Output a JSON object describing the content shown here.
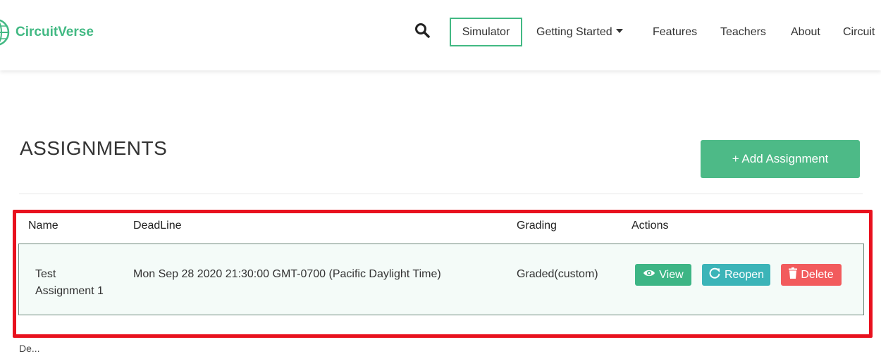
{
  "brand": {
    "name": "CircuitVerse",
    "accent": "#42b983"
  },
  "nav": {
    "search_icon": "search-icon",
    "simulator": "Simulator",
    "getting_started": "Getting Started",
    "features": "Features",
    "teachers": "Teachers",
    "about": "About",
    "circuit_partial": "Circuit"
  },
  "assignments": {
    "title": "ASSIGNMENTS",
    "add_button": "+ Add Assignment",
    "columns": [
      "Name",
      "DeadLine",
      "Grading",
      "Actions"
    ],
    "rows": [
      {
        "name_line1": "Test",
        "name_line2": "Assignment 1",
        "deadline": "Mon Sep 28 2020 21:30:00 GMT-0700 (Pacific Daylight Time)",
        "grading": "Graded(custom)",
        "actions": {
          "view": "View",
          "reopen": "Reopen",
          "delete": "Delete"
        }
      }
    ]
  },
  "colors": {
    "view": "#3db585",
    "reopen": "#3bb4b8",
    "delete": "#f25b5d",
    "highlight": "#e8111e"
  },
  "footer_partial": "De..."
}
